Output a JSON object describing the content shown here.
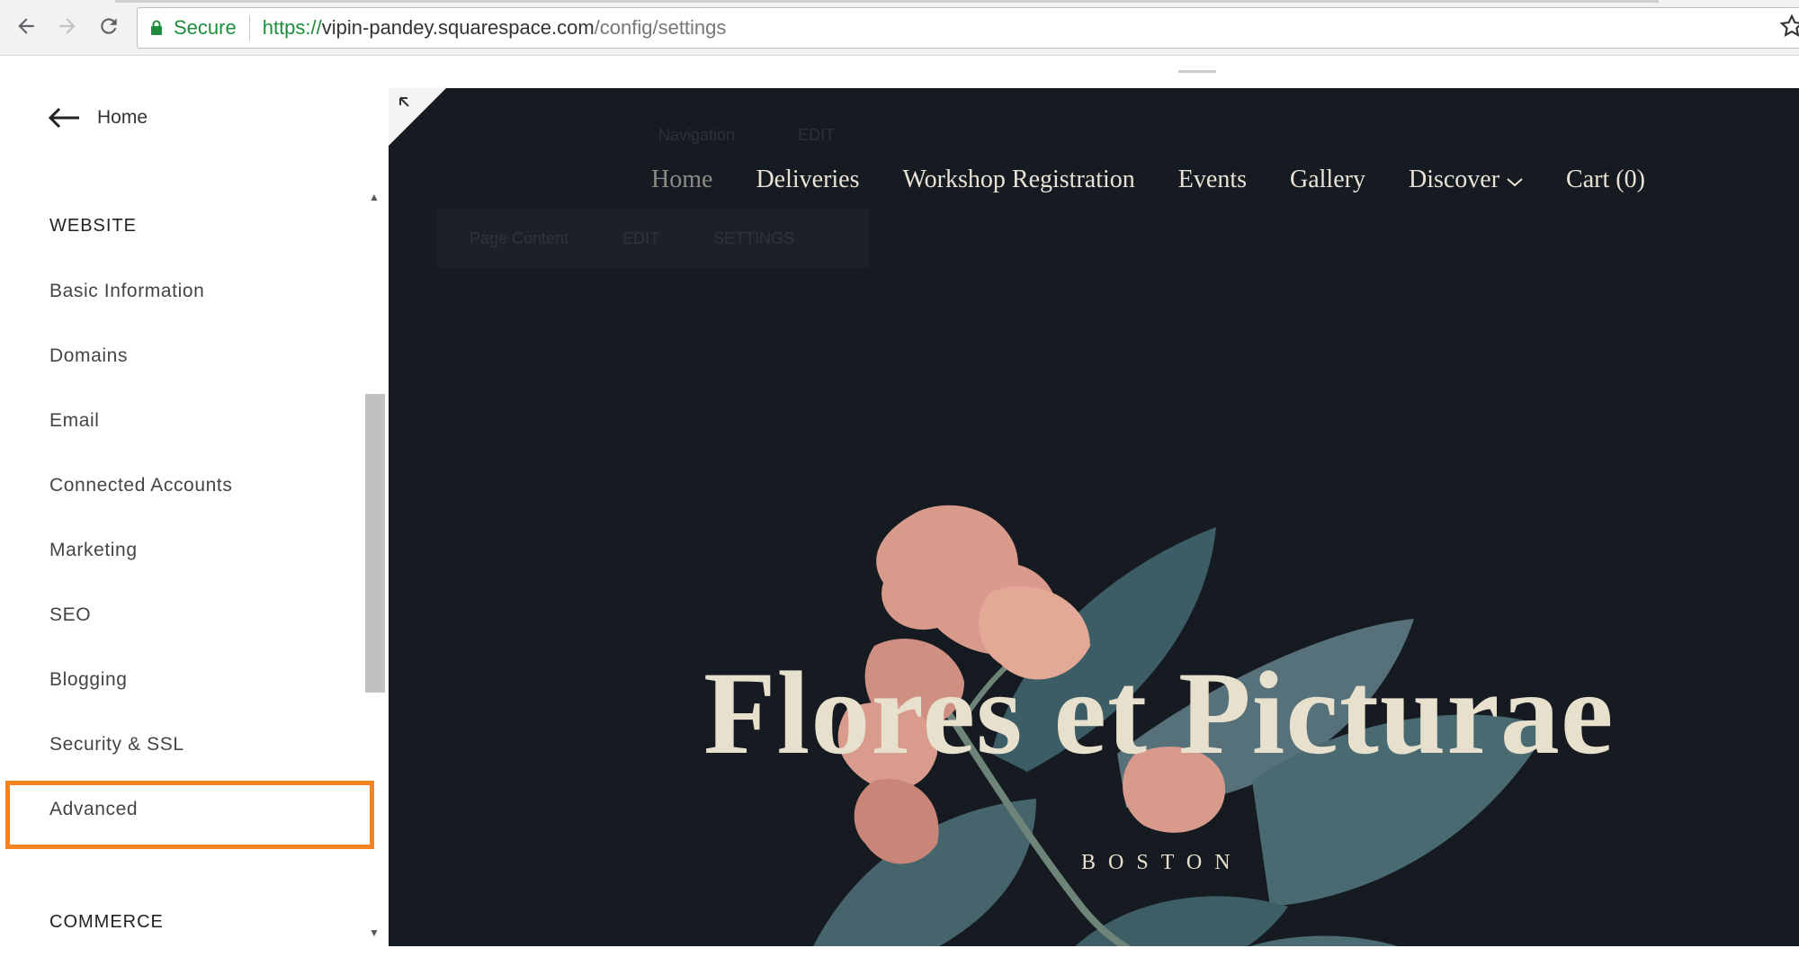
{
  "browser": {
    "secure_label": "Secure",
    "url_protocol": "https://",
    "url_host": "vipin-pandey.squarespace.com",
    "url_path": "/config/settings"
  },
  "sidebar": {
    "back_label": "Home",
    "section_website": "WEBSITE",
    "items": [
      {
        "label": "Basic Information"
      },
      {
        "label": "Domains"
      },
      {
        "label": "Email"
      },
      {
        "label": "Connected Accounts"
      },
      {
        "label": "Marketing"
      },
      {
        "label": "SEO"
      },
      {
        "label": "Blogging"
      },
      {
        "label": "Security & SSL"
      },
      {
        "label": "Advanced"
      }
    ],
    "section_commerce": "COMMERCE"
  },
  "preview": {
    "ghost_nav": {
      "label": "Navigation",
      "edit": "EDIT"
    },
    "ghost_content": {
      "label": "Page Content",
      "edit": "EDIT",
      "settings": "SETTINGS"
    },
    "nav": [
      {
        "label": "Home",
        "active": true
      },
      {
        "label": "Deliveries"
      },
      {
        "label": "Workshop Registration"
      },
      {
        "label": "Events"
      },
      {
        "label": "Gallery"
      },
      {
        "label": "Discover"
      },
      {
        "label": "Cart (0)"
      }
    ],
    "hero_title": "Flores et Picturae",
    "hero_subtitle": "BOSTON"
  },
  "colors": {
    "highlight": "#f58220",
    "preview_bg": "#161a21",
    "hero_text": "#e7e0cc",
    "secure_green": "#1e8e3e"
  }
}
